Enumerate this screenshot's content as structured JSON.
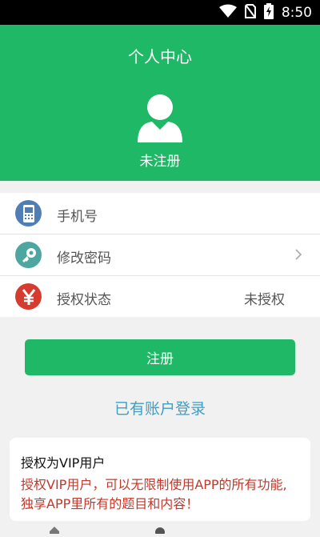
{
  "status_bar": {
    "time": "8:50"
  },
  "header": {
    "title": "个人中心",
    "avatar_status": "未注册"
  },
  "menu": [
    {
      "label": "手机号",
      "value": "",
      "icon": "phone-icon",
      "icon_color": "#4f7eb6"
    },
    {
      "label": "修改密码",
      "value": "",
      "icon": "key-icon",
      "icon_color": "#4ea6a1",
      "has_chevron": true
    },
    {
      "label": "授权状态",
      "value": "未授权",
      "icon": "yen-icon",
      "icon_color": "#d63b2f"
    }
  ],
  "actions": {
    "register_label": "注册",
    "login_link": "已有账户登录"
  },
  "vip_card": {
    "title": "授权为VIP用户",
    "description": "授权VIP用户，可以无限制使用APP的所有功能, 独享APP里所有的题目和内容！"
  },
  "colors": {
    "accent": "#1fb866",
    "link": "#3aa0c8",
    "warning": "#c0392b"
  }
}
